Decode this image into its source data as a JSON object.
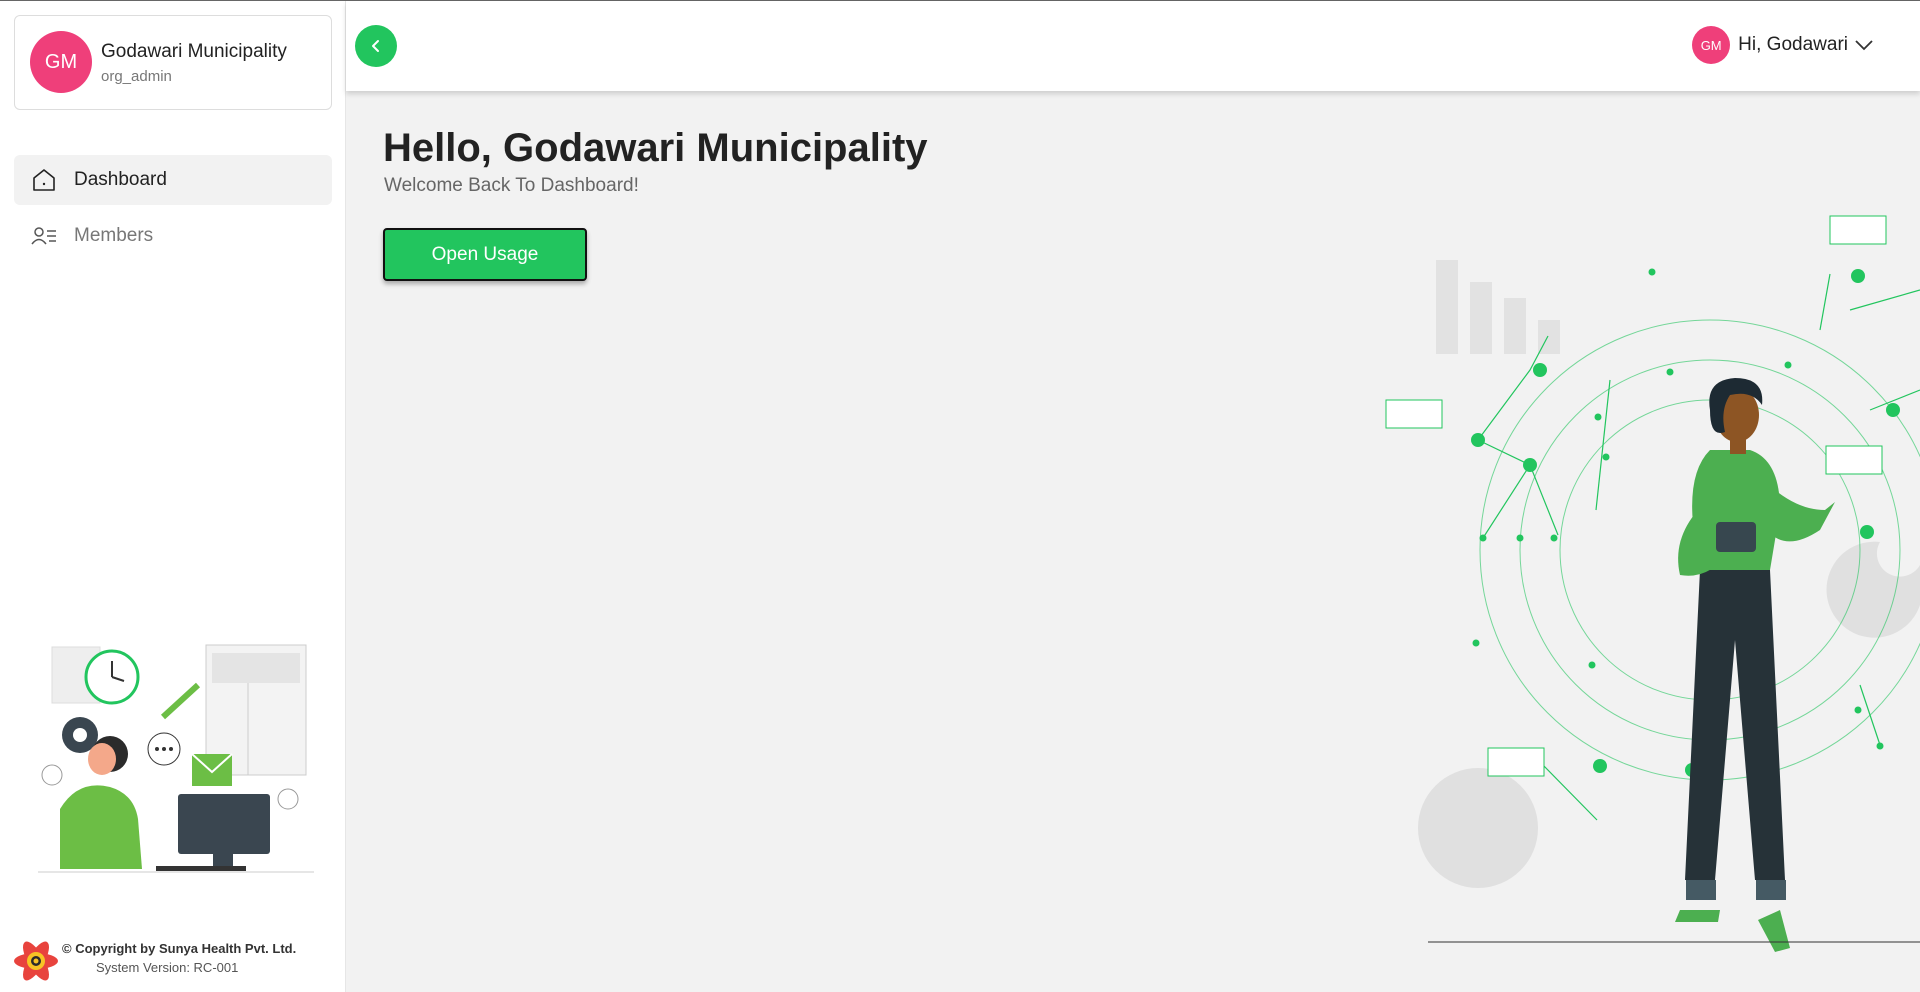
{
  "org": {
    "initials": "GM",
    "name": "Godawari Municipality",
    "role": "org_admin"
  },
  "nav": [
    {
      "label": "Dashboard",
      "icon": "home-icon",
      "active": true
    },
    {
      "label": "Members",
      "icon": "members-icon",
      "active": false
    }
  ],
  "footer": {
    "copyright": "© Copyright by Sunya Health Pvt. Ltd.",
    "version": "System Version: RC-001"
  },
  "header": {
    "user_initials": "GM",
    "greeting": "Hi, Godawari"
  },
  "main": {
    "title": "Hello, Godawari Municipality",
    "subtitle": "Welcome Back To Dashboard!",
    "open_usage_label": "Open Usage"
  },
  "colors": {
    "accent": "#22c55e",
    "avatar": "#ef3f7a",
    "background": "#f2f2f2"
  }
}
